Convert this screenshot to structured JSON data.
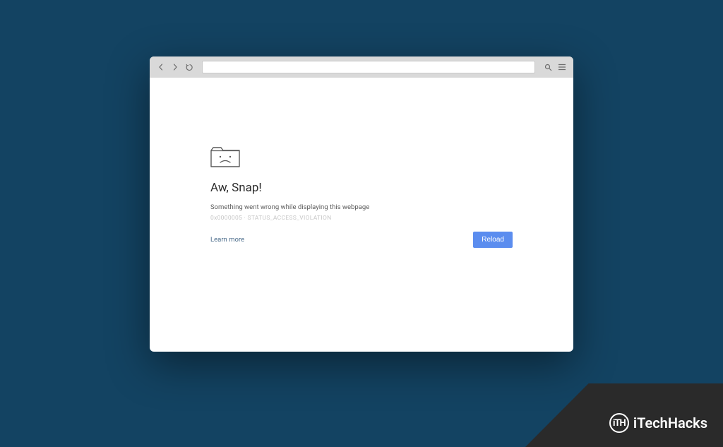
{
  "error": {
    "title": "Aw, Snap!",
    "message": "Something went wrong while displaying this webpage",
    "code": "0x0000005 · STATUS_ACCESS_VIOLATION",
    "learn_more": "Learn more",
    "reload_label": "Reload"
  },
  "watermark": {
    "logo_text": "iTH",
    "brand": "iTechHacks"
  }
}
